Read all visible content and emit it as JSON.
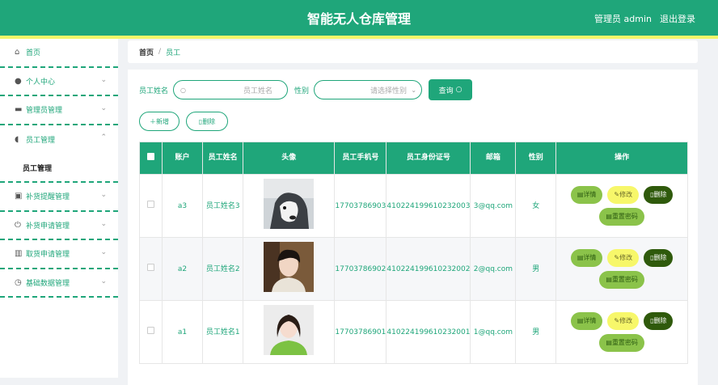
{
  "header": {
    "title": "智能无人仓库管理",
    "user": "管理员 admin",
    "logout": "退出登录"
  },
  "sidebar": {
    "items": [
      {
        "label": "首页",
        "icon": "home-icon",
        "glyph": "⌂",
        "chevron": ""
      },
      {
        "label": "个人中心",
        "icon": "user-icon",
        "glyph": "●",
        "chevron": "⌄"
      },
      {
        "label": "管理员管理",
        "icon": "ticket-icon",
        "glyph": "▬",
        "chevron": "⌄"
      },
      {
        "label": "员工管理",
        "icon": "microphone-icon",
        "glyph": "◖",
        "chevron": "⌃"
      },
      {
        "label": "补货提醒管理",
        "icon": "clipboard-icon",
        "glyph": "▣",
        "chevron": "⌄"
      },
      {
        "label": "补货申请管理",
        "icon": "power-icon",
        "glyph": "⏻",
        "chevron": "⌄"
      },
      {
        "label": "取货申请管理",
        "icon": "bar-chart-icon",
        "glyph": "▥",
        "chevron": "⌄"
      },
      {
        "label": "基础数据管理",
        "icon": "clock-icon",
        "glyph": "◷",
        "chevron": "⌄"
      }
    ],
    "submenu": "员工管理"
  },
  "breadcrumb": {
    "home": "首页",
    "sep": "/",
    "current": "员工"
  },
  "search": {
    "name_label": "员工姓名",
    "name_placeholder": "员工姓名",
    "gender_label": "性别",
    "gender_placeholder": "请选择性别",
    "query_button": "查询"
  },
  "actions": {
    "add": "新增",
    "delete": "删除"
  },
  "table": {
    "headers": [
      "账户",
      "员工姓名",
      "头像",
      "员工手机号",
      "员工身份证号",
      "邮箱",
      "性别",
      "操作"
    ],
    "rows": [
      {
        "account": "a3",
        "name": "员工姓名3",
        "phone": "17703786903",
        "idcard": "410224199610232003",
        "email": "3@qq.com",
        "gender": "女"
      },
      {
        "account": "a2",
        "name": "员工姓名2",
        "phone": "17703786902",
        "idcard": "410224199610232002",
        "email": "2@qq.com",
        "gender": "男"
      },
      {
        "account": "a1",
        "name": "员工姓名1",
        "phone": "17703786901",
        "idcard": "410224199610232001",
        "email": "1@qq.com",
        "gender": "男"
      }
    ],
    "ops": {
      "detail": "详情",
      "edit": "修改",
      "delete": "删除",
      "reset": "重置密码"
    }
  },
  "colors": {
    "primary": "#1fa67a",
    "accent_strip": "#f4f56a",
    "detail": "#8bc34a",
    "edit": "#f7f76a",
    "delete": "#2f5a0c"
  }
}
